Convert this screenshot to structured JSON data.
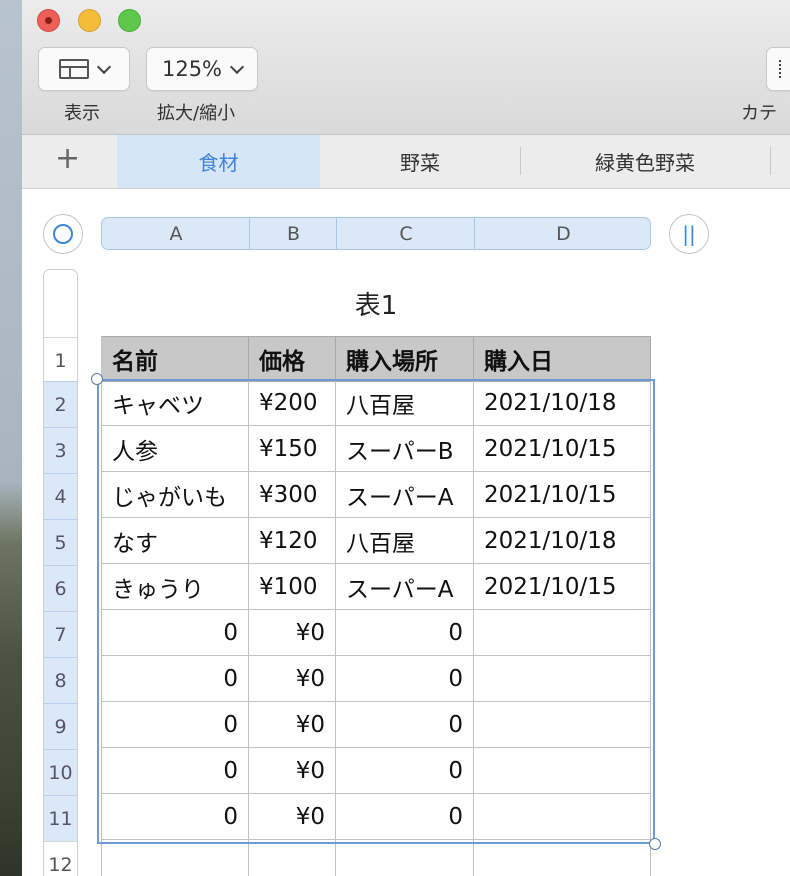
{
  "toolbar": {
    "view_label": "表示",
    "zoom_value": "125%",
    "zoom_label": "拡大/縮小",
    "category_label": "カテ"
  },
  "sheet_tabs": {
    "add_symbol": "+",
    "tabs": [
      "食材",
      "野菜",
      "緑黄色野菜"
    ],
    "active_index": 0
  },
  "table": {
    "title": "表1",
    "column_letters": [
      "A",
      "B",
      "C",
      "D"
    ],
    "row_numbers": [
      "1",
      "2",
      "3",
      "4",
      "5",
      "6",
      "7",
      "8",
      "9",
      "10",
      "11",
      "12"
    ],
    "headers": [
      "名前",
      "価格",
      "購入場所",
      "購入日"
    ],
    "rows": [
      [
        "キャベツ",
        "¥200",
        "八百屋",
        "2021/10/18"
      ],
      [
        "人参",
        "¥150",
        "スーパーB",
        "2021/10/15"
      ],
      [
        "じゃがいも",
        "¥300",
        "スーパーA",
        "2021/10/15"
      ],
      [
        "なす",
        "¥120",
        "八百屋",
        "2021/10/18"
      ],
      [
        "きゅうり",
        "¥100",
        "スーパーA",
        "2021/10/15"
      ],
      [
        "0",
        "¥0",
        "0",
        ""
      ],
      [
        "0",
        "¥0",
        "0",
        ""
      ],
      [
        "0",
        "¥0",
        "0",
        ""
      ],
      [
        "0",
        "¥0",
        "0",
        ""
      ],
      [
        "0",
        "¥0",
        "0",
        ""
      ],
      [
        "",
        "",
        "",
        ""
      ]
    ]
  },
  "colors": {
    "accent": "#3b86da",
    "selection_fill": "#dbe8f8",
    "header_fill": "#c8c8c8"
  }
}
